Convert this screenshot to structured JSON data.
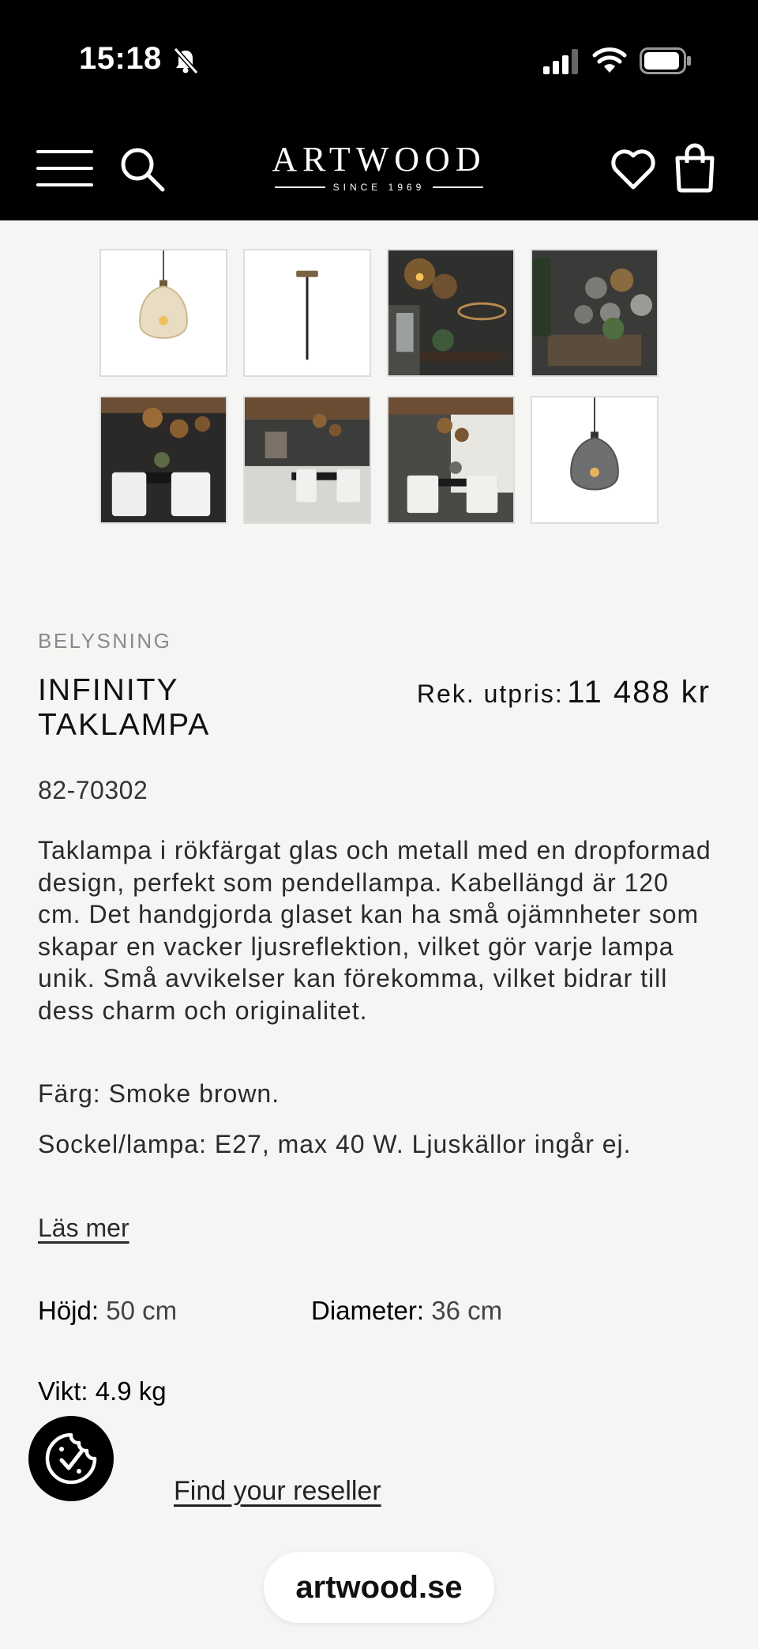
{
  "status_bar": {
    "time": "15:18"
  },
  "header": {
    "logo_word": "ARTWOOD",
    "logo_sub": "SINCE 1969",
    "icons": [
      "menu-icon",
      "search-icon",
      "heart-icon",
      "bag-icon"
    ]
  },
  "gallery": {
    "thumbnails": [
      "amber-pendant-lamp",
      "pendant-rod",
      "dining-room-lamps",
      "glass-globes-wall",
      "dining-room-dark",
      "dining-room-light",
      "dining-room-windows",
      "smoke-pendant-lamp"
    ]
  },
  "product": {
    "category": "BELYSNING",
    "title_line1": "INFINITY",
    "title_line2": "TAKLAMPA",
    "price_label": "Rek. utpris:",
    "price_value": "11 488 kr",
    "sku": "82-70302",
    "description": "Taklampa i rökfärgat glas och metall med en dropformad design, perfekt som pendellampa. Kabellängd är 120 cm. Det handgjorda glaset kan ha små ojämnheter som skapar en vacker ljusreflektion, vilket gör varje lampa unik. Små avvikelser kan förekomma, vilket bidrar till dess charm och originalitet.",
    "color": "Färg: Smoke brown.",
    "socket": "Sockel/lampa: E27, max 40 W. Ljuskällor ingår ej.",
    "read_more": "Läs mer",
    "specs": {
      "height_label": "Höjd:",
      "height_value": "50 cm",
      "diameter_label": "Diameter:",
      "diameter_value": "36 cm",
      "weight_label": "Vikt:",
      "weight_value": "4.9 kg"
    },
    "reseller_link": "Find your reseller"
  },
  "browser": {
    "url": "artwood.se"
  },
  "colors": {
    "header_bg": "#000000",
    "page_bg": "#f5f5f3"
  }
}
